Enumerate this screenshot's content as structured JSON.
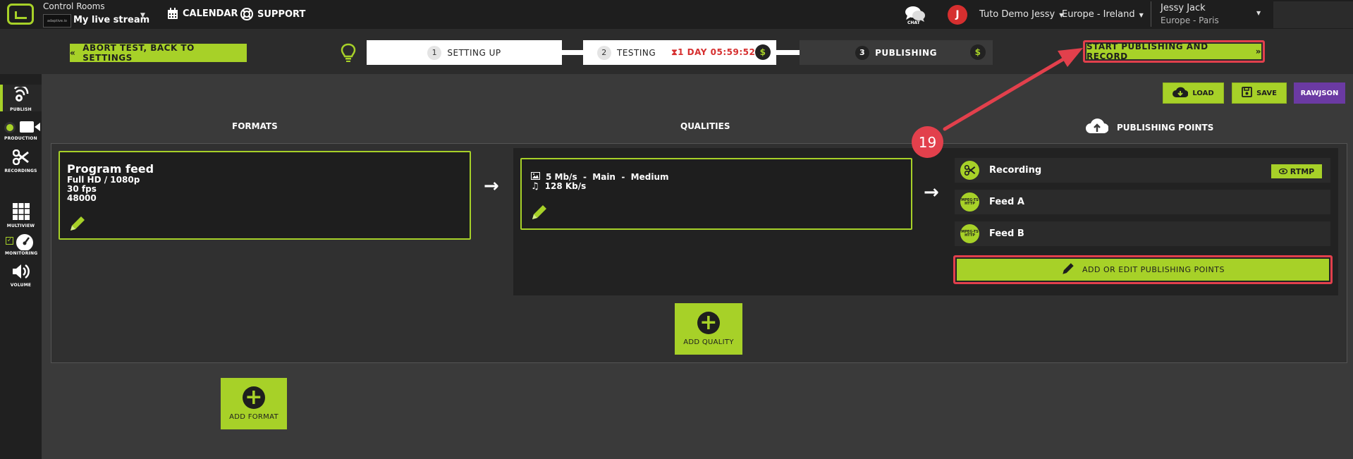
{
  "header": {
    "section_label": "Control Rooms",
    "stream_logo_text": "adaptive.io",
    "stream_name": "My live stream",
    "nav": [
      {
        "label": "CALENDAR",
        "icon": "calendar-icon"
      },
      {
        "label": "SUPPORT",
        "icon": "lifebuoy-icon"
      }
    ],
    "chat_label": "CHAT",
    "avatar_initial": "J",
    "org": "Tuto Demo Jessy",
    "region": "Europe - Ireland",
    "user_name": "Jessy Jack",
    "user_timezone": "Europe - Paris"
  },
  "stepbar": {
    "abort_label": "ABORT TEST, BACK TO SETTINGS",
    "steps": [
      {
        "num": "1",
        "label": "SETTING UP"
      },
      {
        "num": "2",
        "label": "TESTING"
      },
      {
        "num": "3",
        "label": "PUBLISHING"
      }
    ],
    "timer": "1 DAY 05:59:52",
    "dollar": "$",
    "start_label": "START PUBLISHING AND RECORD"
  },
  "sidebar": {
    "items": [
      {
        "label": "PUBLISH",
        "icon": "broadcast-icon",
        "active": true
      },
      {
        "label": "PRODUCTION",
        "icon": "camera-icon"
      },
      {
        "label": "RECORDINGS",
        "icon": "scissors-icon"
      },
      {
        "label": "MULTIVIEW",
        "icon": "grid-icon"
      },
      {
        "label": "MONITORING",
        "icon": "gauge-icon"
      },
      {
        "label": "VOLUME",
        "icon": "speaker-icon"
      }
    ]
  },
  "toolbar": {
    "load_label": "LOAD",
    "save_label": "SAVE",
    "rawjson_label": "RAWJSON"
  },
  "columns": {
    "formats": "FORMATS",
    "qualities": "QUALITIES",
    "publishing_points": "PUBLISHING POINTS"
  },
  "format_card": {
    "title": "Program feed",
    "resolution": "Full HD / 1080p",
    "fps": "30 fps",
    "audio_rate": "48000"
  },
  "quality_card": {
    "video": "5 Mb/s  -  Main  -  Medium",
    "audio": "128 Kb/s"
  },
  "publishing_points": [
    {
      "name": "Recording",
      "icon_text": "",
      "icon": "scissors-icon",
      "badge": "RTMP"
    },
    {
      "name": "Feed A",
      "icon_text": "MPEG-TS HTTP"
    },
    {
      "name": "Feed B",
      "icon_text": "MPEG-TS HTTP"
    }
  ],
  "add_edit_pub_label": "ADD OR EDIT PUBLISHING POINTS",
  "add_quality_label": "ADD QUALITY",
  "add_format_label": "ADD FORMAT",
  "annotation": {
    "callout": "19"
  },
  "colors": {
    "accent": "#a7d128",
    "danger": "#e2404c",
    "purple": "#6b3aa3"
  }
}
